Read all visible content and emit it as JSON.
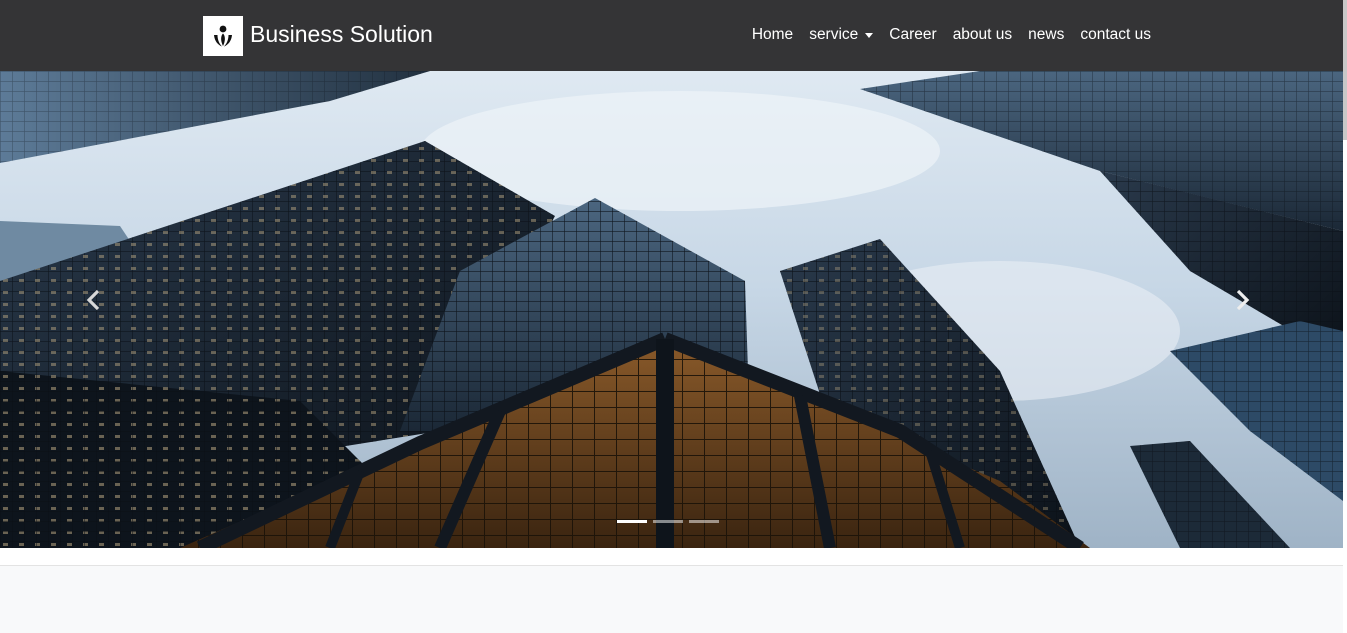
{
  "brand": {
    "name": "Business Solution",
    "logo_icon": "person-logo-icon"
  },
  "nav": {
    "items": [
      {
        "label": "Home"
      },
      {
        "label": "service",
        "has_dropdown": true
      },
      {
        "label": "Career"
      },
      {
        "label": "about us"
      },
      {
        "label": "news"
      },
      {
        "label": "contact us"
      }
    ]
  },
  "carousel": {
    "prev_icon": "chevron-left-icon",
    "next_icon": "chevron-right-icon",
    "slide_count": 3,
    "active_index": 0
  },
  "colors": {
    "navbar_bg": "#343436",
    "nav_text": "#ffffff",
    "page_bg": "#f8f9fa"
  }
}
